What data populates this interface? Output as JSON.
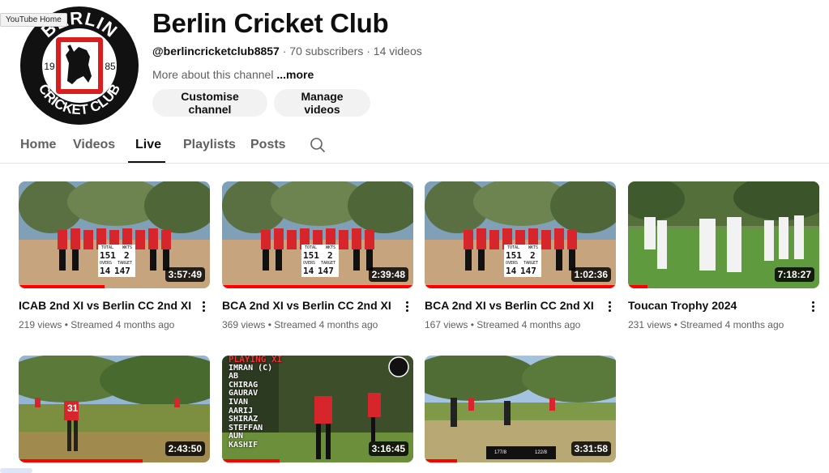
{
  "tooltip": "YouTube Home",
  "channel": {
    "title": "Berlin Cricket Club",
    "handle": "@berlincricketclub8857",
    "subscribers": "70 subscribers",
    "videos": "14 videos",
    "separator": "·",
    "about": "More about this channel",
    "more": "...more",
    "logo": {
      "top": "BERLIN",
      "bottom": "CRICKET CLUB",
      "year_left": "19",
      "year_right": "85"
    }
  },
  "buttons": {
    "customise": "Customise channel",
    "manage": "Manage videos"
  },
  "tabs": [
    "Home",
    "Videos",
    "Live",
    "Playlists",
    "Posts"
  ],
  "active_tab": "Live",
  "videos": [
    {
      "title": "ICAB 2nd XI vs Berlin CC 2nd XI",
      "views": "219 views",
      "streamed": "Streamed 4 months ago",
      "duration": "3:57:49",
      "progress": 0.45
    },
    {
      "title": "BCA 2nd XI vs Berlin CC 2nd XI",
      "views": "369 views",
      "streamed": "Streamed 4 months ago",
      "duration": "2:39:48",
      "progress": 1.0
    },
    {
      "title": "BCA 2nd XI vs Berlin CC 2nd XI",
      "views": "167 views",
      "streamed": "Streamed 4 months ago",
      "duration": "1:02:36",
      "progress": 1.0
    },
    {
      "title": "Toucan Trophy 2024",
      "views": "231 views",
      "streamed": "Streamed 4 months ago",
      "duration": "7:18:27",
      "progress": 0.1
    },
    {
      "duration": "2:43:50",
      "progress": 0.65
    },
    {
      "duration": "3:16:45",
      "progress": 0.3
    },
    {
      "duration": "3:31:58",
      "progress": 0.17
    }
  ],
  "scoreboard": {
    "total": "TOTAL",
    "wkts": "WKTS",
    "overs": "OVERS",
    "target": "TARGET",
    "total_val": "151",
    "wkts_val": "2",
    "overs_val": "14",
    "target_val": "147"
  },
  "lineup": {
    "heading": "PLAYING XI",
    "players": [
      "IMRAN (C)",
      "AB",
      "CHIRAG",
      "GAURAV",
      "IVAN",
      "AARIJ",
      "SHIRAZ",
      "STEFFAN",
      "AUN",
      "KASHIF"
    ]
  },
  "player_number": "31",
  "mini_score": {
    "left": "177/8",
    "right": "122/8"
  },
  "colors": {
    "accent": "#ff0000",
    "text": "#0f0f0f",
    "muted": "#606060",
    "chip": "#f2f2f2"
  }
}
